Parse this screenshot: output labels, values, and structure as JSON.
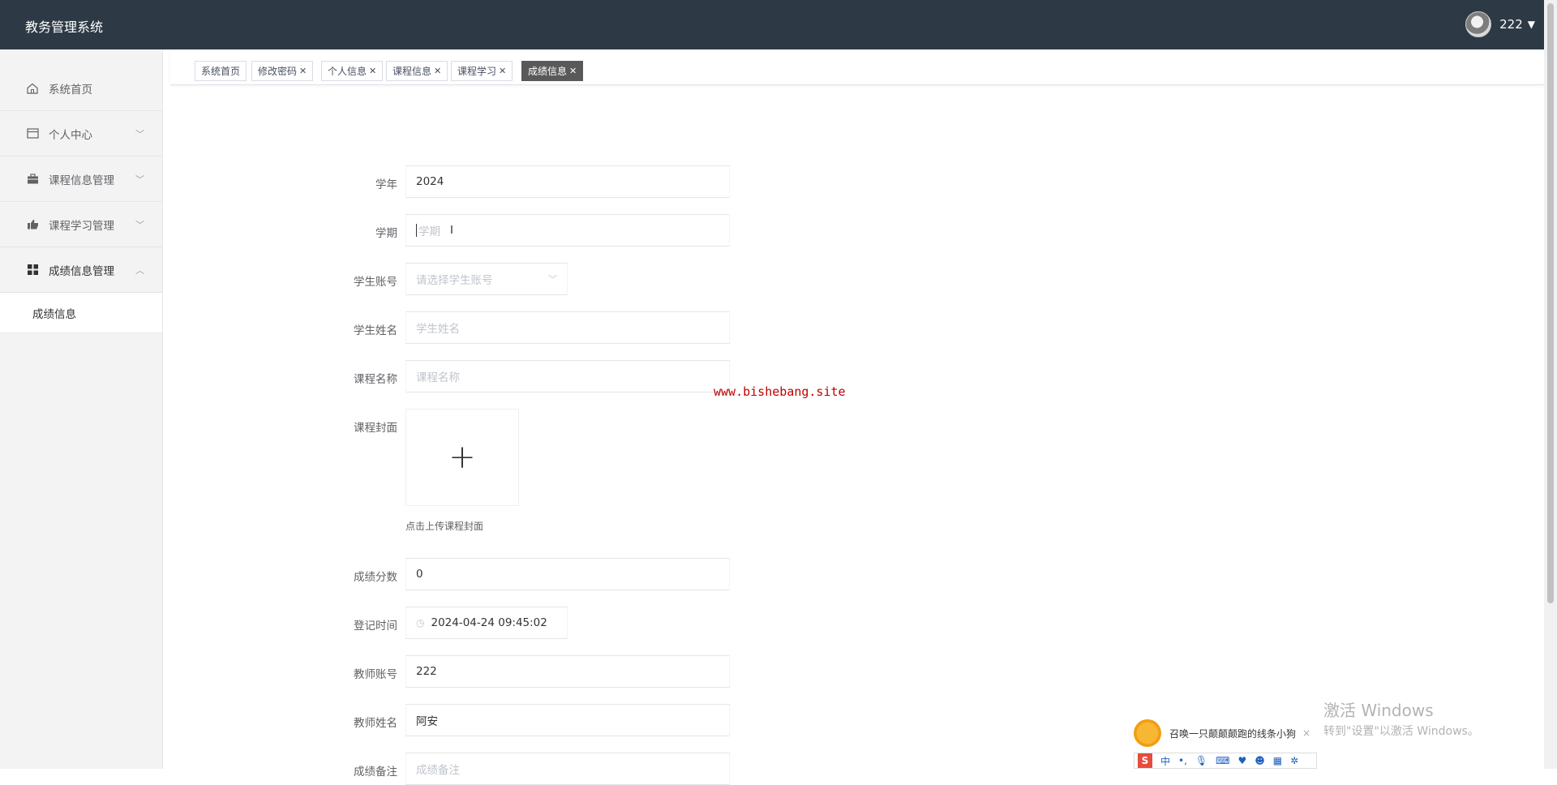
{
  "header": {
    "title": "教务管理系统",
    "username": "222"
  },
  "sidebar": {
    "items": [
      {
        "label": "系统首页",
        "icon": "home-icon",
        "expandable": false
      },
      {
        "label": "个人中心",
        "icon": "card-icon",
        "expandable": true
      },
      {
        "label": "课程信息管理",
        "icon": "briefcase-icon",
        "expandable": true
      },
      {
        "label": "课程学习管理",
        "icon": "thumb-icon",
        "expandable": true
      },
      {
        "label": "成绩信息管理",
        "icon": "grid-icon",
        "expandable": true,
        "expanded": true
      }
    ],
    "submenu": [
      {
        "label": "成绩信息"
      }
    ]
  },
  "tabs": [
    {
      "label": "系统首页",
      "closable": false
    },
    {
      "label": "修改密码",
      "closable": true
    },
    {
      "label": "个人信息",
      "closable": true
    },
    {
      "label": "课程信息",
      "closable": true
    },
    {
      "label": "课程学习",
      "closable": true
    },
    {
      "label": "成绩信息",
      "closable": true,
      "active": true
    }
  ],
  "form": {
    "year": {
      "label": "学年",
      "value": "2024"
    },
    "term": {
      "label": "学期",
      "placeholder": "学期"
    },
    "student_account": {
      "label": "学生账号",
      "placeholder": "请选择学生账号"
    },
    "student_name": {
      "label": "学生姓名",
      "placeholder": "学生姓名"
    },
    "course_name": {
      "label": "课程名称",
      "placeholder": "课程名称"
    },
    "course_cover": {
      "label": "课程封面",
      "plus": "+",
      "tip": "点击上传课程封面"
    },
    "score": {
      "label": "成绩分数",
      "value": "0"
    },
    "register_time": {
      "label": "登记时间",
      "value": "2024-04-24 09:45:02"
    },
    "teacher_account": {
      "label": "教师账号",
      "value": "222"
    },
    "teacher_name": {
      "label": "教师姓名",
      "value": "阿安"
    },
    "remark": {
      "label": "成绩备注",
      "placeholder": "成绩备注"
    }
  },
  "overlays": {
    "watermark": "www.bishebang.site",
    "windows_activation_title": "激活 Windows",
    "windows_activation_sub": "转到\"设置\"以激活 Windows。",
    "ime_tip": "召唤一只颠颠颠跑的线条小狗",
    "ime_logo": "S",
    "ime_mode": "中"
  },
  "colors": {
    "header_bg": "#2d3a45",
    "active_tab_bg": "#595959",
    "watermark": "#c00000"
  }
}
